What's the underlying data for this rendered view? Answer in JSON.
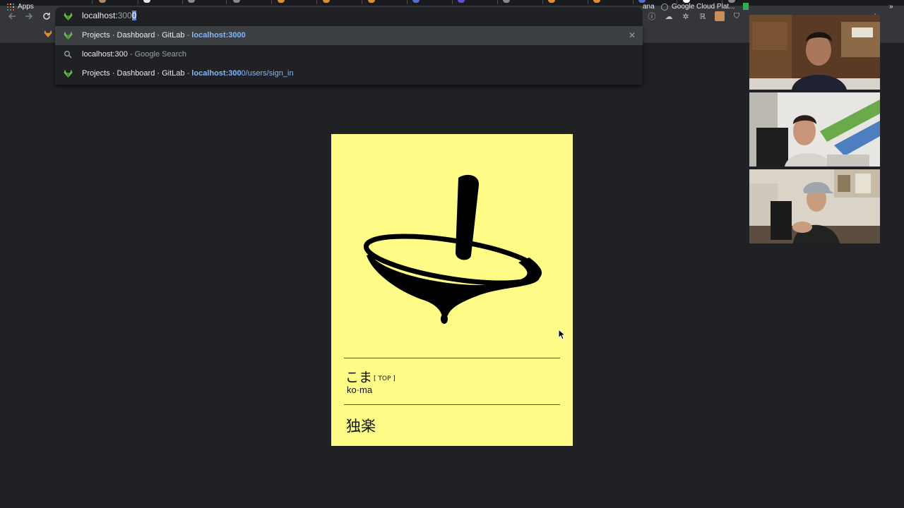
{
  "omnibox": {
    "typed": "localhost:",
    "autocomplete_dim": "300",
    "autocomplete_selected": "0"
  },
  "bookmarks": {
    "apps_label": "Apps",
    "partial_label": "ana",
    "cloud_label": "Google Cloud Plat...",
    "more_label": "»"
  },
  "suggestions": [
    {
      "title": "Projects · Dashboard · GitLab",
      "separator": " - ",
      "url_bold": "localhost:3000",
      "url_rest": ""
    },
    {
      "title": "localhost:300",
      "separator": " - ",
      "suffix": "Google Search"
    },
    {
      "title": "Projects · Dashboard · GitLab",
      "separator": " - ",
      "url_bold": "localhost:300",
      "url_rest": "0/users/sign_in"
    }
  ],
  "card": {
    "kana": "こま",
    "tag": "[ TOP ]",
    "romaji": "ko·ma",
    "kanji": "独楽",
    "background": "#fefb86"
  },
  "colors": {
    "page_bg": "#202124",
    "toolbar_bg": "#35363a",
    "dropdown_highlight": "#3c4043",
    "link_blue": "#8ab4f8",
    "gitlab_green": "#6fbf4f"
  }
}
